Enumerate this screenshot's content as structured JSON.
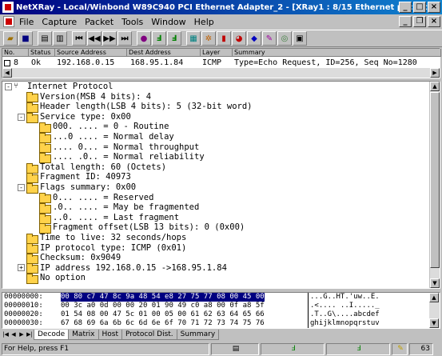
{
  "window": {
    "title": "NetXRay - Local/Winbond W89C940 PCI Ethernet Adapter_2 - [XRay1 : 8/15 Ethernet packets]"
  },
  "menu": [
    "File",
    "Capture",
    "Packet",
    "Tools",
    "Window",
    "Help"
  ],
  "toolbar": {
    "icons": [
      "open-icon",
      "save-icon",
      "print-icon",
      "print-preview-icon",
      "first-packet-icon",
      "previous-packet-icon",
      "next-packet-icon",
      "last-packet-icon",
      "capture-icon",
      "decode-icon",
      "hex-icon",
      "filter-icon",
      "host-table-icon",
      "matrix-icon",
      "chart-icon",
      "pie-icon",
      "history-icon",
      "alarm-icon",
      "settings-icon",
      "info-icon"
    ]
  },
  "packet_list": {
    "headers": [
      "No.",
      "Status",
      "Source Address",
      "Dest Address",
      "Layer",
      "Summary"
    ],
    "row": {
      "no": "8",
      "status": "Ok",
      "source": "192.168.0.15",
      "dest": "168.95.1.84",
      "layer": "ICMP",
      "summary": "Type=Echo Request, ID=256, Seq No=1280"
    }
  },
  "tree": [
    {
      "text": "Internet Protocol",
      "level": 0,
      "kind": "root",
      "expander": "-"
    },
    {
      "text": "Version(MSB 4 bits): 4",
      "level": 1,
      "kind": "leaf"
    },
    {
      "text": "Header length(LSB 4 bits): 5 (32-bit word)",
      "level": 1,
      "kind": "leaf"
    },
    {
      "text": "Service type: 0x00",
      "level": 1,
      "kind": "folder",
      "expander": "-"
    },
    {
      "text": "000. .... = 0 - Routine",
      "level": 2,
      "kind": "leaf"
    },
    {
      "text": "...0 .... = Normal delay",
      "level": 2,
      "kind": "leaf"
    },
    {
      "text": ".... 0... = Normal throughput",
      "level": 2,
      "kind": "leaf"
    },
    {
      "text": ".... .0.. = Normal reliability",
      "level": 2,
      "kind": "leaf"
    },
    {
      "text": "Total length: 60 (Octets)",
      "level": 1,
      "kind": "leaf"
    },
    {
      "text": "Fragment ID: 40973",
      "level": 1,
      "kind": "leaf"
    },
    {
      "text": "Flags summary: 0x00",
      "level": 1,
      "kind": "folder",
      "expander": "-"
    },
    {
      "text": "0... .... = Reserved",
      "level": 2,
      "kind": "leaf"
    },
    {
      "text": ".0.. .... = May be fragmented",
      "level": 2,
      "kind": "leaf"
    },
    {
      "text": "..0. .... = Last fragment",
      "level": 2,
      "kind": "leaf"
    },
    {
      "text": "Fragment offset(LSB 13 bits): 0 (0x00)",
      "level": 2,
      "kind": "leaf"
    },
    {
      "text": "Time to live: 32 seconds/hops",
      "level": 1,
      "kind": "leaf"
    },
    {
      "text": "IP protocol type: ICMP (0x01)",
      "level": 1,
      "kind": "leaf"
    },
    {
      "text": "Checksum: 0x9049",
      "level": 1,
      "kind": "leaf"
    },
    {
      "text": "IP address 192.168.0.15 ->168.95.1.84",
      "level": 1,
      "kind": "folder",
      "expander": "+"
    },
    {
      "text": "No option",
      "level": 1,
      "kind": "leaf"
    }
  ],
  "hex": [
    {
      "off": "00000000:",
      "bytes": "00 80 c7 47 8c 9a 48 54 e8 27 75 77 08 00 45 00",
      "ascii": "...G..HT.'uw..E."
    },
    {
      "off": "00000010:",
      "bytes": "00 3c a0 0d 00 00 20 01 90 49 c0 a8 00 0f a8 5f",
      "ascii": ".<.... ..I....._"
    },
    {
      "off": "00000020:",
      "bytes": "01 54 08 00 47 5c 01 00 05 00 61 62 63 64 65 66",
      "ascii": ".T..G\\....abcdef"
    },
    {
      "off": "00000030:",
      "bytes": "67 68 69 6a 6b 6c 6d 6e 6f 70 71 72 73 74 75 76",
      "ascii": "ghijklmnopqrstuv"
    }
  ],
  "tabs": [
    "Decode",
    "Matrix",
    "Host",
    "Protocol Dist.",
    "Summary"
  ],
  "status": {
    "help": "For Help, press F1",
    "count": "63"
  }
}
